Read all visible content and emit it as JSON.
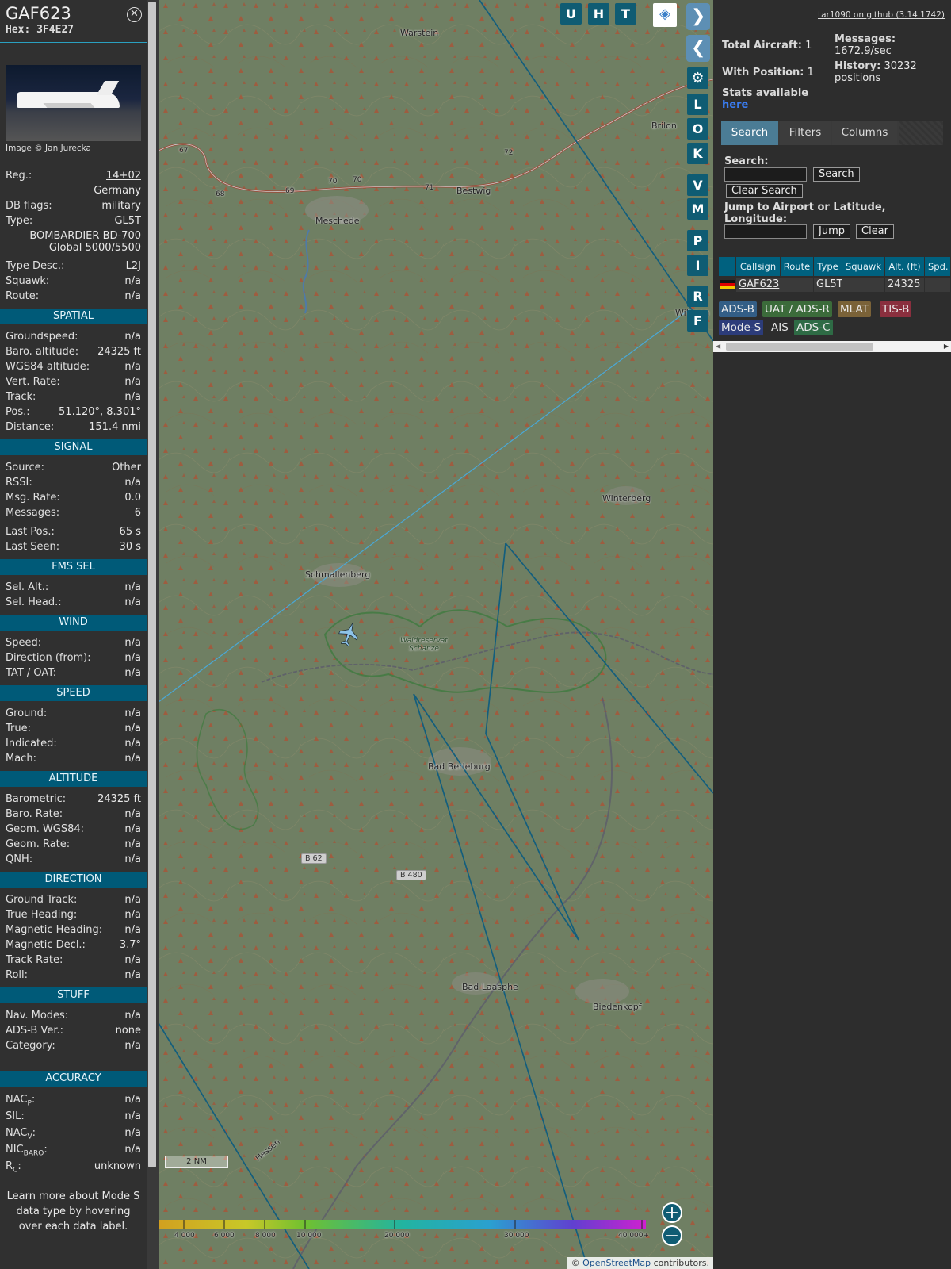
{
  "aircraft": {
    "callsign": "GAF623",
    "hex": "Hex: 3F4E27",
    "image_credit": "Image © Jan Jurecka",
    "details": [
      {
        "key": "Reg.:",
        "value": "14+02"
      },
      {
        "key": "",
        "value": "Germany"
      },
      {
        "key": "DB flags:",
        "value": "military"
      },
      {
        "key": "Type:",
        "value": "GL5T"
      },
      {
        "key": "",
        "value": "BOMBARDIER BD-700 Global 5000/5500"
      },
      {
        "key": "Type Desc.:",
        "value": "L2J"
      },
      {
        "key": "Squawk:",
        "value": "n/a"
      },
      {
        "key": "Route:",
        "value": "n/a"
      }
    ]
  },
  "sections": [
    {
      "title": "SPATIAL",
      "rows": [
        {
          "key": "Groundspeed:",
          "value": "n/a"
        },
        {
          "key": "Baro. altitude:",
          "value": "24325 ft"
        },
        {
          "key": "WGS84 altitude:",
          "value": "n/a"
        },
        {
          "key": "Vert. Rate:",
          "value": "n/a"
        },
        {
          "key": "Track:",
          "value": "n/a"
        },
        {
          "key": "Pos.:",
          "value": "51.120°, 8.301°"
        },
        {
          "key": "Distance:",
          "value": "151.4 nmi"
        }
      ]
    },
    {
      "title": "SIGNAL",
      "rows": [
        {
          "key": "Source:",
          "value": "Other"
        },
        {
          "key": "RSSI:",
          "value": "n/a"
        },
        {
          "key": "Msg. Rate:",
          "value": "0.0"
        },
        {
          "key": "Messages:",
          "value": "6"
        },
        {
          "key": "Last Pos.:",
          "value": "65 s"
        },
        {
          "key": "Last Seen:",
          "value": "30 s"
        }
      ]
    },
    {
      "title": "FMS SEL",
      "rows": [
        {
          "key": "Sel. Alt.:",
          "value": "n/a"
        },
        {
          "key": "Sel. Head.:",
          "value": "n/a"
        }
      ]
    },
    {
      "title": "WIND",
      "rows": [
        {
          "key": "Speed:",
          "value": "n/a"
        },
        {
          "key": "Direction (from):",
          "value": "n/a"
        },
        {
          "key": "TAT / OAT:",
          "value": "n/a"
        }
      ]
    },
    {
      "title": "SPEED",
      "rows": [
        {
          "key": "Ground:",
          "value": "n/a"
        },
        {
          "key": "True:",
          "value": "n/a"
        },
        {
          "key": "Indicated:",
          "value": "n/a"
        },
        {
          "key": "Mach:",
          "value": "n/a"
        }
      ]
    },
    {
      "title": "ALTITUDE",
      "rows": [
        {
          "key": "Barometric:",
          "value": "24325 ft"
        },
        {
          "key": "Baro. Rate:",
          "value": "n/a"
        },
        {
          "key": "Geom. WGS84:",
          "value": "n/a"
        },
        {
          "key": "Geom. Rate:",
          "value": "n/a"
        },
        {
          "key": "QNH:",
          "value": "n/a"
        }
      ]
    },
    {
      "title": "DIRECTION",
      "rows": [
        {
          "key": "Ground Track:",
          "value": "n/a"
        },
        {
          "key": "True Heading:",
          "value": "n/a"
        },
        {
          "key": "Magnetic Heading:",
          "value": "n/a"
        },
        {
          "key": "Magnetic Decl.:",
          "value": "3.7°"
        },
        {
          "key": "Track Rate:",
          "value": "n/a"
        },
        {
          "key": "Roll:",
          "value": "n/a"
        }
      ]
    },
    {
      "title": "STUFF",
      "rows": [
        {
          "key": "Nav. Modes:",
          "value": "n/a"
        },
        {
          "key": "ADS-B Ver.:",
          "value": "none"
        },
        {
          "key": "Category:",
          "value": "n/a"
        }
      ]
    }
  ],
  "accuracy": {
    "title": "ACCURACY",
    "rows": [
      {
        "key": "NAC",
        "sub": "P",
        "value": "n/a"
      },
      {
        "key": "SIL:",
        "sub": "",
        "value": "n/a"
      },
      {
        "key": "NAC",
        "sub": "V",
        "value": "n/a"
      },
      {
        "key": "NIC",
        "sub": "BARO",
        "value": "n/a"
      },
      {
        "key": "R",
        "sub": "C",
        "value": "unknown"
      }
    ],
    "learn_more": "Learn more about Mode S data type by hovering over each data label."
  },
  "map": {
    "places": [
      {
        "name": "Warstein"
      },
      {
        "name": "Brilon"
      },
      {
        "name": "Bestwig"
      },
      {
        "name": "Meschede"
      },
      {
        "name": "Wilsgen"
      },
      {
        "name": "Winterberg"
      },
      {
        "name": "Schmallenberg"
      },
      {
        "name": "Waldreservat Schanze"
      },
      {
        "name": "Bad Berleburg"
      },
      {
        "name": "Bad Laasphe"
      },
      {
        "name": "Biedenkopf"
      },
      {
        "name": "Hessen"
      }
    ],
    "road_badges": [
      "B 62",
      "B 480"
    ],
    "road_numbers": [
      "67",
      "68",
      "69",
      "70",
      "70",
      "71",
      "72"
    ],
    "buttons": [
      "U",
      "H",
      "T",
      "L",
      "O",
      "K",
      "V",
      "M",
      "P",
      "I",
      "R",
      "F"
    ],
    "altitude_scale": [
      "4 000",
      "6 000",
      "8 000",
      "10 000",
      "20 000",
      "30 000",
      "40 000+"
    ],
    "scale_bar": "2 NM",
    "attribution_prefix": "© ",
    "attribution_link": "OpenStreetMap",
    "attribution_suffix": " contributors."
  },
  "side": {
    "github": "tar1090 on github (3.14.1742)",
    "total_aircraft_label": "Total Aircraft:",
    "total_aircraft": "1",
    "with_position_label": "With Position:",
    "with_position": "1",
    "messages_label": "Messages:",
    "messages": "1672.9/sec",
    "history_label": "History:",
    "history": "30232 positions",
    "stats_text": "Stats available",
    "stats_link": "here",
    "tabs": [
      "Search",
      "Filters",
      "Columns"
    ],
    "search_label": "Search:",
    "search_button": "Search",
    "clear_search": "Clear Search",
    "jump_label": "Jump to Airport or Latitude, Longitude:",
    "jump_button": "Jump",
    "clear_button": "Clear",
    "columns": [
      "Callsign",
      "Route",
      "Type",
      "Squawk",
      "Alt. (ft)",
      "Spd."
    ],
    "rows": [
      {
        "callsign": "GAF623",
        "route": "",
        "type": "GL5T",
        "squawk": "",
        "alt": "24325",
        "spd": ""
      }
    ],
    "badges": [
      {
        "label": "ADS-B",
        "color": "#335e86"
      },
      {
        "label": "UAT / ADS-R",
        "color": "#3b6b3a"
      },
      {
        "label": "MLAT",
        "color": "#7a6238"
      },
      {
        "label": "TIS-B",
        "color": "#8a2f3e"
      },
      {
        "label": "Mode-S",
        "color": "#2c3c7a"
      },
      {
        "label": "AIS",
        "color": "#2d2d2d"
      },
      {
        "label": "ADS-C",
        "color": "#2e6b45"
      }
    ]
  }
}
